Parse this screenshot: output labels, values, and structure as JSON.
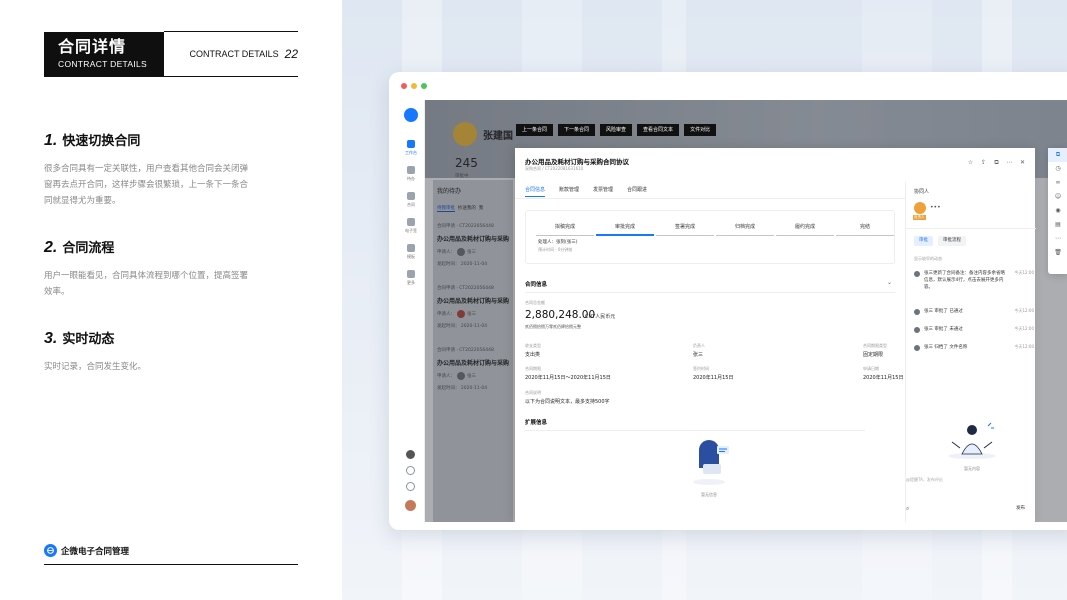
{
  "left": {
    "header_title": "合同详情",
    "header_subtitle": "CONTRACT DETAILS",
    "header_right_text": "CONTRACT DETAILS",
    "page_number": "22",
    "sections": [
      {
        "num": "1.",
        "title": "快速切换合同",
        "text": "很多合同具有一定关联性，用户查看其他合同会关闭弹窗再去点开合同，这样步骤会很繁琐，上一条下一条合同就显得尤为重要。"
      },
      {
        "num": "2.",
        "title": "合同流程",
        "text": "用户一眼能看见，合同具体流程到哪个位置，提高签署效率。"
      },
      {
        "num": "3.",
        "title": "实时动态",
        "text": "实时记录，合同发生变化。"
      }
    ],
    "brand": "企微电子合同管理"
  },
  "rail": {
    "items": [
      "工作台",
      "待办",
      "合同",
      "电子签",
      "模板",
      "更多"
    ]
  },
  "bgpage": {
    "user_name": "张建国",
    "count": "245",
    "count_label": "审批中",
    "list_title": "我的待办",
    "tabs": [
      "待我审批",
      "抄送我的",
      "我"
    ],
    "cards": [
      {
        "l1": "合同申请 · CT2022056448",
        "l2": "办公用品及耗材订购与采购合同",
        "applicant_label": "申请人：",
        "applicant": "张三",
        "time": "发起时间： 2020-11-04"
      },
      {
        "l1": "合同申请 · CT2022056448",
        "l2": "办公用品及耗材订购与采购合同",
        "applicant_label": "申请人：",
        "applicant": "张三",
        "time": "发起时间： 2020-11-04"
      },
      {
        "l1": "合同申请 · CT2022056448",
        "l2": "办公用品及耗材订购与采购合同",
        "applicant_label": "申请人：",
        "applicant": "张三",
        "time": "发起时间： 2020-11-04"
      }
    ]
  },
  "toolbar": {
    "buttons": [
      "上一条合同",
      "下一条合同",
      "风险审查",
      "查看合同文本",
      "文件对比"
    ]
  },
  "drawer": {
    "title": "办公用品及耗材订购与采购合同协议",
    "id": "采购合同 / CT2022081631610",
    "tabs": [
      "合同信息",
      "账款管理",
      "发票管理",
      "合同跟进"
    ],
    "steps": [
      "拟稿完成",
      "审批完成",
      "签署完成",
      "归档完成",
      "履约完成",
      "完结"
    ],
    "step_handler": "处理人：张刻(张三)",
    "step_time": "预计时间 · 0分钟前",
    "info_title": "合同信息",
    "amount_label": "合同总金额",
    "amount": "2,880,248.00",
    "amount_unit": "CNY人民币元",
    "amount_caption": "贰佰捌拾捌万零贰佰肆拾捌元整",
    "fields": [
      {
        "k": "收支类型",
        "v": "支出类"
      },
      {
        "k": "负责人",
        "v": "张三"
      },
      {
        "k": "合同期限类型",
        "v": "固定期限"
      },
      {
        "k": "合同期限",
        "v": "2020年11月15日～2020年11月15日"
      },
      {
        "k": "签约时间",
        "v": "2020年11月15日"
      },
      {
        "k": "申请日期",
        "v": "2020年11月15日"
      },
      {
        "k": "合同说明",
        "v": "以下为合同说明文本，最多支持500字"
      }
    ],
    "ext_title": "扩展信息",
    "empty": "暂无信息"
  },
  "collab": {
    "title": "协同人",
    "avatar_label": "负责人",
    "tabs": [
      "审批",
      "审批流程"
    ],
    "show_more": "显示较早的动态",
    "logs": [
      {
        "text": "张三更新了合同备注：备注内容多余省略信息，默认展示4行，点击去展开更多内容。",
        "time": "今天12:00"
      },
      {
        "text": "张三  审批了  已通过",
        "time": "今天12:00"
      },
      {
        "text": "张三  审批了  未通过",
        "time": "今天12:00"
      },
      {
        "text": "张三  归档了  文件名称",
        "time": "今天12:00"
      }
    ],
    "empty": "暂无内容",
    "input_placeholder": "@提醒TA，发布评论",
    "send": "发布"
  },
  "colors": {
    "accent": "#1677ff",
    "header_black": "#0f0f0f"
  }
}
